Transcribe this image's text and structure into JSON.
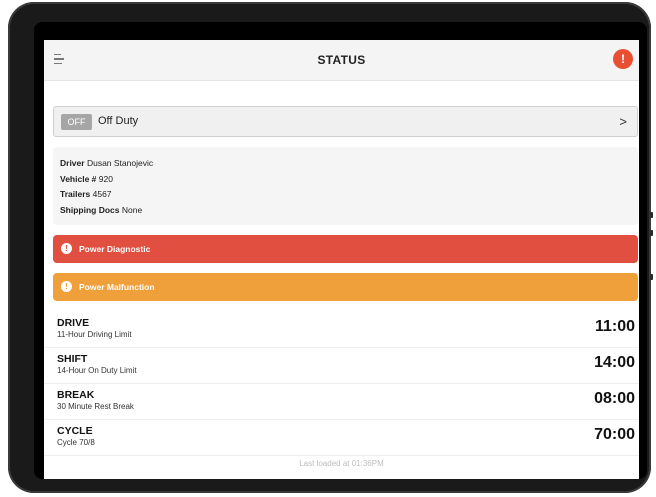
{
  "header": {
    "title": "STATUS",
    "menu_icon": "menu-icon",
    "alert_icon": "alert-icon",
    "alert_glyph": "!",
    "alert_color": "#e94f33"
  },
  "duty_status": {
    "badge": "OFF",
    "label": "Off Duty",
    "chevron": ">"
  },
  "info": {
    "driver_label": "Driver",
    "driver_value": "Dusan Stanojevic",
    "vehicle_label": "Vehicle #",
    "vehicle_value": "920",
    "trailers_label": "Trailers",
    "trailers_value": "4567",
    "docs_label": "Shipping Docs",
    "docs_value": "None"
  },
  "alerts": [
    {
      "label": "Power Diagnostic",
      "glyph": "!",
      "color": "#e04f3f"
    },
    {
      "label": "Power Malfunction",
      "glyph": "!",
      "color": "#f0a03a"
    }
  ],
  "clocks": [
    {
      "name": "DRIVE",
      "description": "11-Hour Driving Limit",
      "time": "11:00"
    },
    {
      "name": "SHIFT",
      "description": "14-Hour On Duty Limit",
      "time": "14:00"
    },
    {
      "name": "BREAK",
      "description": "30 Minute Rest Break",
      "time": "08:00"
    },
    {
      "name": "CYCLE",
      "description": "Cycle 70/8",
      "time": "70:00"
    }
  ],
  "footer": {
    "last_loaded": "Last loaded at 01:36PM"
  }
}
